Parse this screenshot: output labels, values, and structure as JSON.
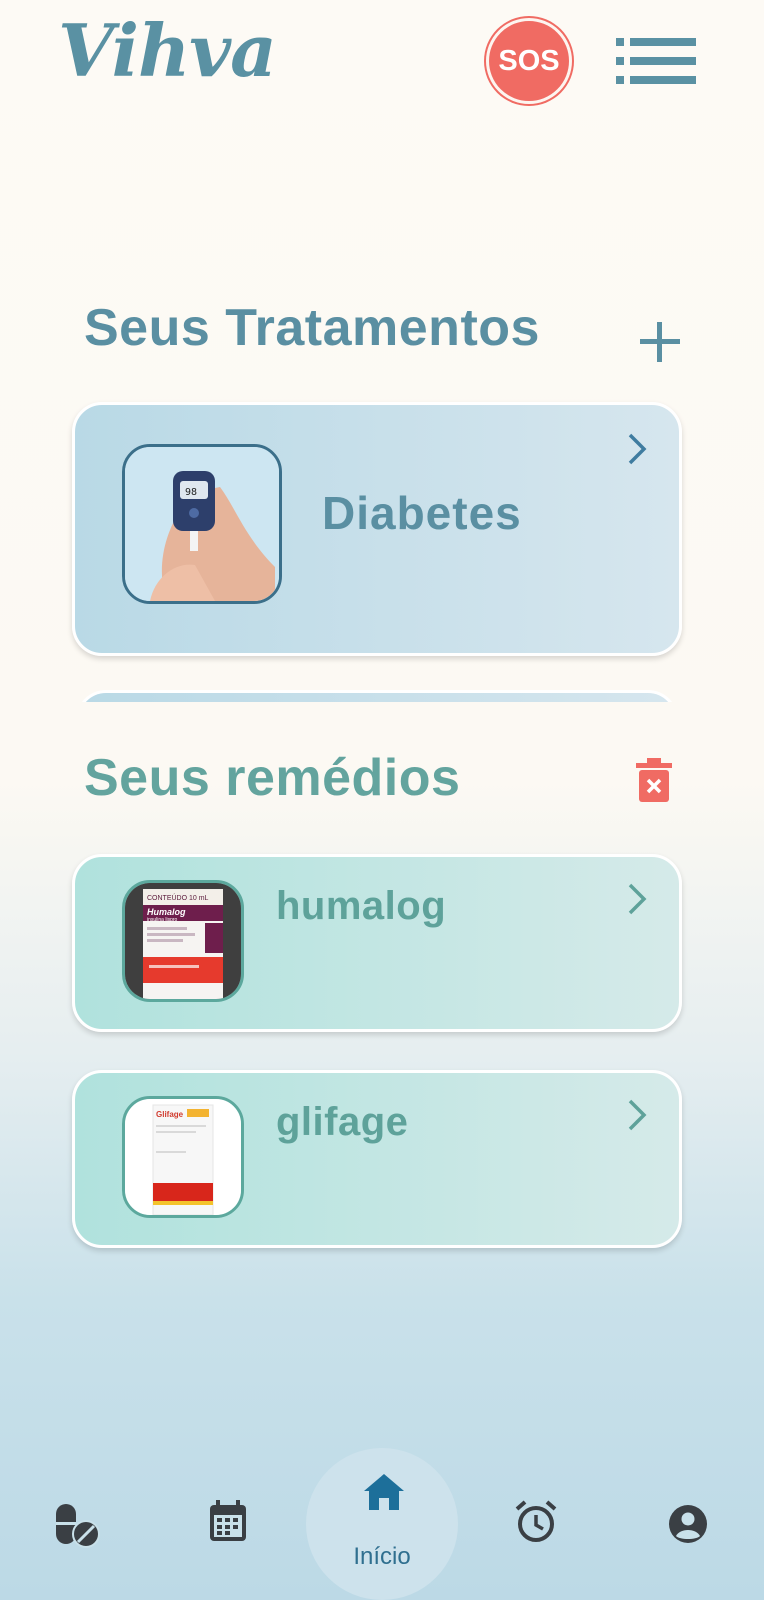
{
  "header": {
    "logo": "Vihva",
    "sos_label": "SOS",
    "menu_icon": "menu-icon"
  },
  "treatments": {
    "title": "Seus Tratamentos",
    "add_icon": "plus-icon",
    "items": [
      {
        "name": "Diabetes",
        "image": "glucose-meter-photo"
      }
    ]
  },
  "medicines": {
    "title": "Seus remédios",
    "delete_icon": "trash-icon",
    "items": [
      {
        "name": "humalog",
        "image": "humalog-box-photo",
        "box_text": "CONTEÚDO 10 mL",
        "box_brand": "Humalog",
        "box_sub": "insulina lispro"
      },
      {
        "name": "glifage",
        "image": "glifage-box-photo",
        "box_brand": "Glifage"
      }
    ]
  },
  "nav": {
    "items": [
      {
        "icon": "pills-icon"
      },
      {
        "icon": "calendar-icon"
      },
      {
        "icon": "home-icon",
        "label": "Início",
        "active": true
      },
      {
        "icon": "alarm-icon"
      },
      {
        "icon": "profile-icon"
      }
    ]
  },
  "colors": {
    "primary": "#5a8fa2",
    "medicine": "#63a49e",
    "sos": "#f06b63",
    "nav_active": "#2f6f8f"
  }
}
